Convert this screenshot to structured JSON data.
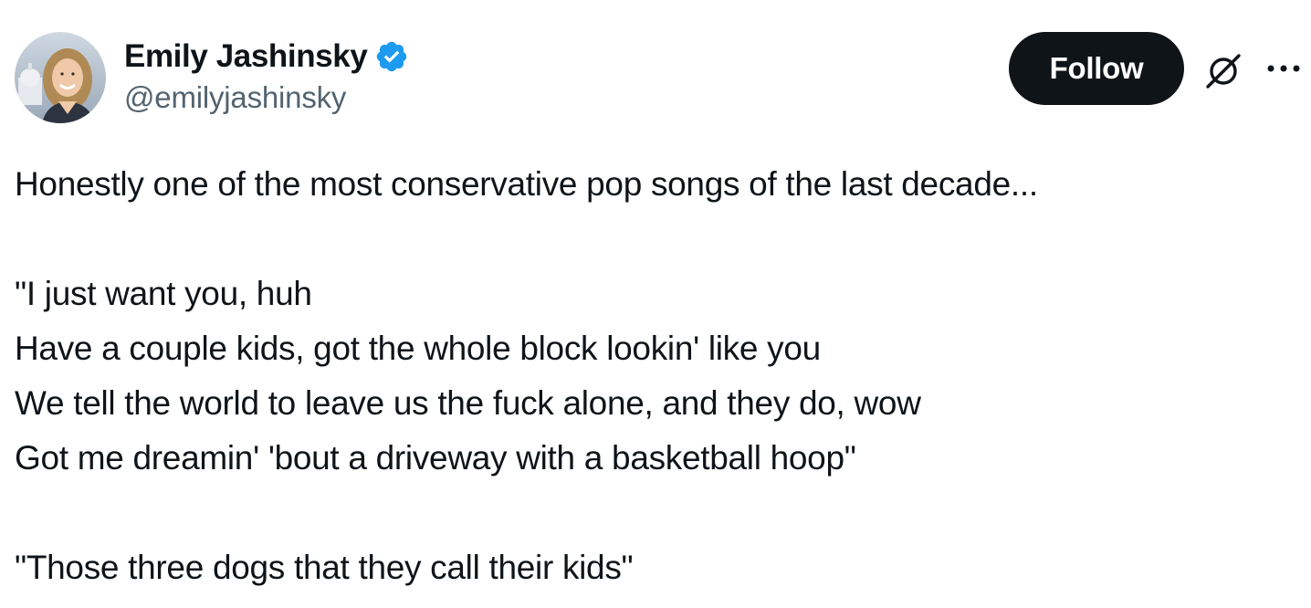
{
  "author": {
    "display_name": "Emily Jashinsky",
    "handle": "@emilyjashinsky",
    "verified": true
  },
  "actions": {
    "follow_label": "Follow",
    "grok_icon": "grok-icon",
    "more_icon": "more-icon"
  },
  "tweet": {
    "intro": "Honestly one of the most conservative pop songs of the last decade...",
    "lyrics": [
      "\"I just want you, huh",
      "Have a couple kids, got the whole block lookin' like you",
      "We tell the world to leave us the fuck alone, and they do, wow",
      "Got me dreamin' 'bout a driveway with a basketball hoop\""
    ],
    "closing": "\"Those three dogs that they call their kids\""
  },
  "colors": {
    "text": "#0f1419",
    "secondary": "#536471",
    "verified_blue": "#1d9bf0",
    "button_bg": "#0f1419",
    "button_text": "#ffffff"
  }
}
